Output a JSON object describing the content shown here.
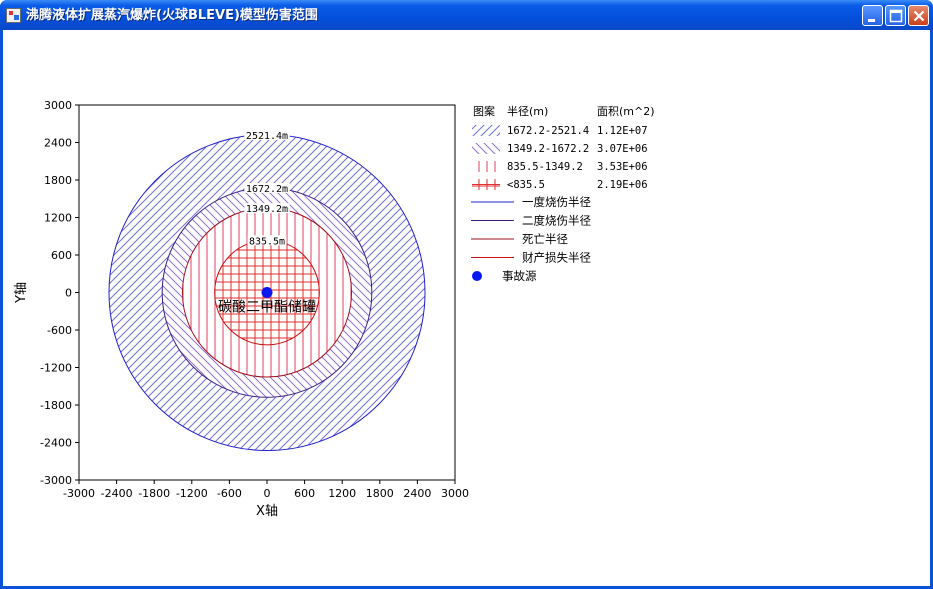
{
  "window": {
    "title": "沸腾液体扩展蒸汽爆炸(火球BLEVE)模型伤害范围",
    "buttons": [
      "minimize",
      "maximize",
      "close"
    ]
  },
  "chart_data": {
    "type": "scatter",
    "xlabel": "X轴",
    "ylabel": "Y轴",
    "xlim": [
      -3000,
      3000
    ],
    "ylim": [
      -3000,
      3000
    ],
    "xticks": [
      -3000,
      -2400,
      -1800,
      -1200,
      -600,
      0,
      600,
      1200,
      1800,
      2400,
      3000
    ],
    "yticks": [
      3000,
      2400,
      1800,
      1200,
      600,
      0,
      -600,
      -1200,
      -1800,
      -2400,
      -3000
    ],
    "xtick_labels": [
      "-3000",
      "-2400",
      "-1800",
      "-1200",
      "-600",
      "0",
      "600",
      "1200",
      "1800",
      "2400",
      "3000"
    ],
    "ytick_labels": [
      "3000",
      "2400",
      "1800",
      "1200",
      "600",
      "0",
      "-600",
      "-1200",
      "-1800",
      "-2400",
      "-3000"
    ],
    "source": {
      "x": 0,
      "y": 0,
      "label": "碳酸二甲酯储罐"
    },
    "rings": [
      {
        "radius": 2521.4,
        "label": "2521.4m",
        "color": "#2020c8",
        "hatch_color": "#7070e0",
        "hatch": "diagonal-right"
      },
      {
        "radius": 1672.2,
        "label": "1672.2m",
        "color": "#3a2080",
        "hatch_color": "#9070d0",
        "hatch": "diagonal-left"
      },
      {
        "radius": 1349.2,
        "label": "1349.2m",
        "color": "#a01020",
        "hatch_color": "#e04060",
        "hatch": "vertical"
      },
      {
        "radius": 835.5,
        "label": "835.5m",
        "color": "#c81010",
        "hatch_color": "#e03030",
        "hatch": "grid"
      }
    ],
    "legend": {
      "headers": [
        "图案",
        "半径(m)",
        "面积(m^2)"
      ],
      "area_entries": [
        {
          "radius": "1672.2-2521.4",
          "area": "1.12E+07",
          "hatch": "diagonal-right",
          "color": "#7070e0"
        },
        {
          "radius": "1349.2-1672.2",
          "area": "3.07E+06",
          "hatch": "diagonal-left",
          "color": "#9070d0"
        },
        {
          "radius": "835.5-1349.2",
          "area": "3.53E+06",
          "hatch": "vertical",
          "color": "#e04060"
        },
        {
          "radius": "<835.5",
          "area": "2.19E+06",
          "hatch": "grid",
          "color": "#e03030"
        }
      ],
      "line_entries": [
        {
          "label": "一度烧伤半径",
          "color": "#2020c8"
        },
        {
          "label": "二度烧伤半径",
          "color": "#3a2080"
        },
        {
          "label": "死亡半径",
          "color": "#a01020"
        },
        {
          "label": "财产损失半径",
          "color": "#c81010"
        }
      ],
      "point_entry": {
        "label": "事故源",
        "color": "#0a18f0"
      }
    }
  }
}
